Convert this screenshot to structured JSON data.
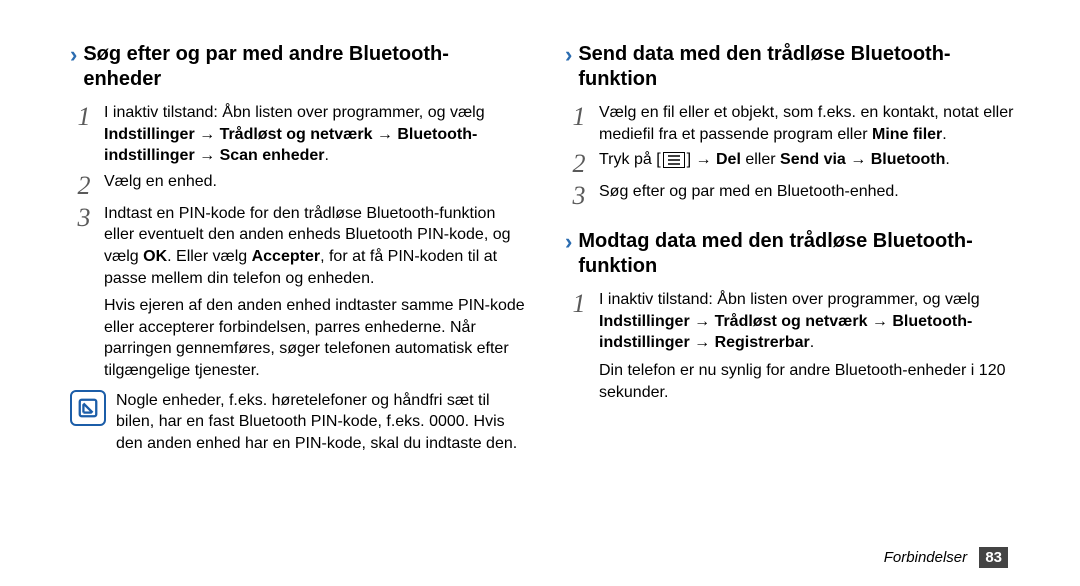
{
  "left": {
    "heading": "Søg efter og par med andre Bluetooth-enheder",
    "step1a": "I inaktiv tilstand: Åbn listen over programmer, og vælg ",
    "step1b": "Indstillinger → Trådløst og netværk → Bluetooth-indstillinger → Scan enheder",
    "step1c": ".",
    "step2": "Vælg en enhed.",
    "step3a": "Indtast en PIN-kode for den trådløse Bluetooth-funktion eller eventuelt den anden enheds Bluetooth PIN-kode, og vælg ",
    "step3ok": "OK",
    "step3b": ". Eller vælg ",
    "step3acc": "Accepter",
    "step3c": ", for at få PIN-koden til at passe mellem din telefon og enheden.",
    "para1": "Hvis ejeren af den anden enhed indtaster samme PIN-kode eller accepterer forbindelsen, parres enhederne. Når parringen gennemføres, søger telefonen automatisk efter tilgængelige tjenester.",
    "note": "Nogle enheder, f.eks. høretelefoner og håndfri sæt til bilen, har en fast Bluetooth PIN-kode, f.eks. 0000. Hvis den anden enhed har en PIN-kode, skal du indtaste den."
  },
  "right": {
    "heading1": "Send data med den trådløse Bluetooth-funktion",
    "s1a": "Vælg en fil eller et objekt, som f.eks. en kontakt, notat eller mediefil fra et passende program eller ",
    "s1b": "Mine filer",
    "s1c": ".",
    "s2a": "Tryk på [",
    "s2b": "] → ",
    "s2del": "Del",
    "s2c": " eller ",
    "s2send": "Send via",
    "s2d": " → ",
    "s2bt": "Bluetooth",
    "s2e": ".",
    "s3": "Søg efter og par med en Bluetooth-enhed.",
    "heading2": "Modtag data med den trådløse Bluetooth-funktion",
    "m1a": "I inaktiv tilstand: Åbn listen over programmer, og vælg ",
    "m1b": "Indstillinger → Trådløst og netværk → Bluetooth-indstillinger → Registrerbar",
    "m1c": ".",
    "para2": "Din telefon er nu synlig for andre Bluetooth-enheder i 120 sekunder."
  },
  "footer": {
    "label": "Forbindelser",
    "page": "83"
  }
}
